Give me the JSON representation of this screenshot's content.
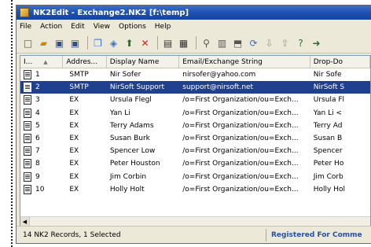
{
  "window": {
    "title": "NK2Edit - Exchange2.NK2 [f:\\temp]"
  },
  "menu": [
    "File",
    "Action",
    "Edit",
    "View",
    "Options",
    "Help"
  ],
  "toolbar": [
    {
      "icon": "new-file-icon",
      "glyph": "□"
    },
    {
      "icon": "open-folder-icon",
      "glyph": "▰"
    },
    {
      "icon": "save-icon",
      "glyph": "▣"
    },
    {
      "icon": "save-as-icon",
      "glyph": "▣"
    },
    {
      "sep": true
    },
    {
      "icon": "copy-icon",
      "glyph": "❐"
    },
    {
      "icon": "properties-icon",
      "glyph": "◈"
    },
    {
      "icon": "add-record-icon",
      "glyph": "⬆"
    },
    {
      "icon": "delete-icon",
      "glyph": "✕"
    },
    {
      "sep": true
    },
    {
      "icon": "view-icon",
      "glyph": "▤"
    },
    {
      "icon": "grid-icon",
      "glyph": "▦"
    },
    {
      "sep": true
    },
    {
      "icon": "find-icon",
      "glyph": "⚲"
    },
    {
      "icon": "report-icon",
      "glyph": "▥"
    },
    {
      "icon": "export-icon",
      "glyph": "⬒"
    },
    {
      "icon": "refresh-icon",
      "glyph": "⟳"
    },
    {
      "icon": "move-down-icon",
      "glyph": "⇩"
    },
    {
      "icon": "move-up-icon",
      "glyph": "⇧"
    },
    {
      "icon": "help-icon",
      "glyph": "?"
    },
    {
      "icon": "exit-icon",
      "glyph": "➜"
    }
  ],
  "list": {
    "columns": [
      "I...",
      "Addres...",
      "Display Name",
      "Email/Exchange String",
      "Drop-Do"
    ],
    "rows": [
      {
        "index": "1",
        "type": "SMTP",
        "name": "Nir Sofer",
        "email": "nirsofer@yahoo.com",
        "drop": "Nir Sofe",
        "selected": false
      },
      {
        "index": "2",
        "type": "SMTP",
        "name": "NirSoft Support",
        "email": "support@nirsoft.net",
        "drop": "NirSoft S",
        "selected": true
      },
      {
        "index": "3",
        "type": "EX",
        "name": "Ursula Flegl",
        "email": "/o=First Organization/ou=Exch...",
        "drop": "Ursula Fl",
        "selected": false
      },
      {
        "index": "4",
        "type": "EX",
        "name": "Yan Li",
        "email": "/o=First Organization/ou=Exch...",
        "drop": "Yan Li <",
        "selected": false
      },
      {
        "index": "5",
        "type": "EX",
        "name": "Terry Adams",
        "email": "/o=First Organization/ou=Exch...",
        "drop": "Terry Ad",
        "selected": false
      },
      {
        "index": "6",
        "type": "EX",
        "name": "Susan Burk",
        "email": "/o=First Organization/ou=Exch...",
        "drop": "Susan B",
        "selected": false
      },
      {
        "index": "7",
        "type": "EX",
        "name": "Spencer Low",
        "email": "/o=First Organization/ou=Exch...",
        "drop": "Spencer",
        "selected": false
      },
      {
        "index": "8",
        "type": "EX",
        "name": "Peter Houston",
        "email": "/o=First Organization/ou=Exch...",
        "drop": "Peter Ho",
        "selected": false
      },
      {
        "index": "9",
        "type": "EX",
        "name": "Jim Corbin",
        "email": "/o=First Organization/ou=Exch...",
        "drop": "Jim Corb",
        "selected": false
      },
      {
        "index": "10",
        "type": "EX",
        "name": "Holly Holt",
        "email": "/o=First Organization/ou=Exch...",
        "drop": "Holly Hol",
        "selected": false
      }
    ]
  },
  "status": {
    "records": "14 NK2 Records, 1 Selected",
    "registered": "Registered For Comme"
  },
  "colors": {
    "selection": "#1f3f8f",
    "titlebar": "#1c4fb0",
    "registered_text": "#2a4f9c"
  }
}
